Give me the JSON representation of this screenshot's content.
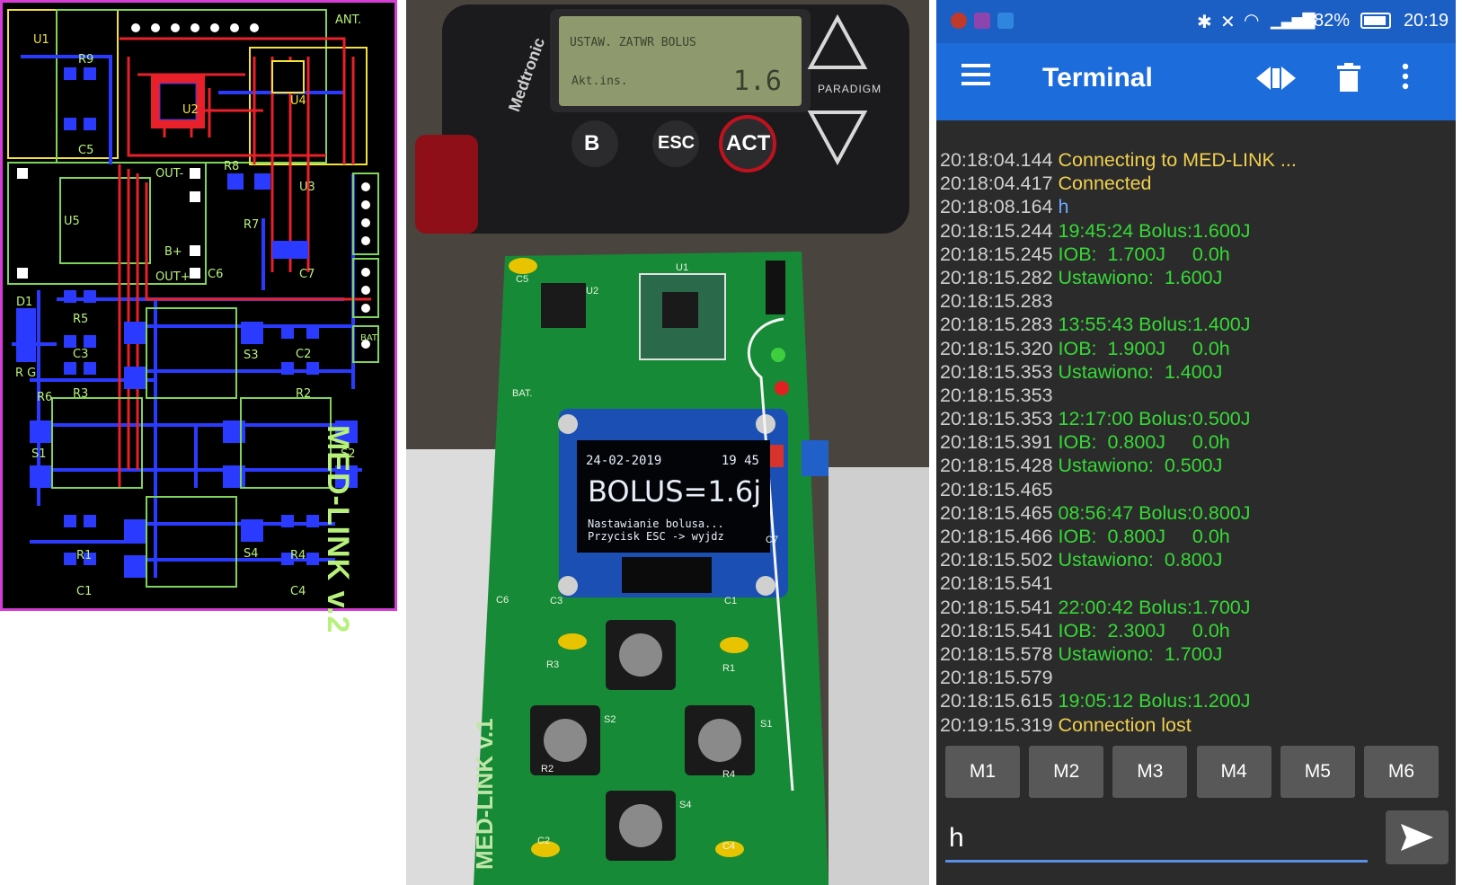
{
  "pcb": {
    "labels": {
      "u1": "U1",
      "u2": "U2",
      "u4": "U4",
      "u3": "U3",
      "u5": "U5",
      "r9": "R9",
      "r8": "R8",
      "r7": "R7",
      "r5": "R5",
      "r3": "R3",
      "r2": "R2",
      "r1": "R1",
      "r4": "R4",
      "r6": "R6",
      "c5": "C5",
      "c6": "C6",
      "c7": "C7",
      "c3": "C3",
      "c2": "C2",
      "c1": "C1",
      "c4": "C4",
      "d1": "D1",
      "s1": "S1",
      "s2": "S2",
      "s3": "S3",
      "s4": "S4",
      "ant": "ANT.",
      "b": "B+",
      "out_minus": "OUT-",
      "out_plus": "OUT+",
      "bat": "BAT.",
      "rg": "R G"
    },
    "board_title": "MED-LINK v.2"
  },
  "photo": {
    "pump_screen": {
      "line1": "USTAW. ZATWR BOLUS",
      "line2": "Akt.ins.",
      "value": "1.6"
    },
    "pump_brand": "Medtronic",
    "paradigm": "PARADIGM",
    "pump_buttons": {
      "b": "B",
      "esc": "ESC",
      "act": "ACT"
    },
    "oled": {
      "date": "24-02-2019",
      "time": "19 45",
      "bolus": "BOLUS=1.6j",
      "line1": "Nastawianie bolusa...",
      "line2": "Przycisk ESC -> wyjdz"
    },
    "board_labels": {
      "bat": "BAT.",
      "u1": "U1",
      "u2": "U2",
      "c5": "C5",
      "c6": "C6",
      "c7": "C7",
      "c3": "C3",
      "c1": "C1",
      "c2": "C2",
      "c4": "C4",
      "r1": "R1",
      "r2": "R2",
      "r3": "R3",
      "r4": "R4",
      "s1": "S1",
      "s2": "S2",
      "s4": "S4"
    },
    "board_name": "MED-LINK v.1"
  },
  "phone": {
    "status": {
      "battery": "82%",
      "time": "20:19"
    },
    "toolbar": {
      "title": "Terminal",
      "menu_icon": "hamburger-icon",
      "connect_icon": "connect-icon",
      "delete_icon": "trash-icon",
      "more_icon": "more-vert-icon"
    },
    "colors": {
      "yellow": "#f0cf4e",
      "green": "#36d936",
      "blue": "#6ea8ff",
      "ts": "#cfcfcf"
    },
    "log": [
      {
        "ts": "20:18:04.144",
        "msg": "Connecting to MED-LINK ...",
        "kind": "yellow"
      },
      {
        "ts": "20:18:04.417",
        "msg": "Connected",
        "kind": "yellow"
      },
      {
        "ts": "20:18:08.164",
        "msg": "h",
        "kind": "blue"
      },
      {
        "ts": "20:18:15.244",
        "msg": "19:45:24 Bolus:1.600J",
        "kind": "green"
      },
      {
        "ts": "20:18:15.245",
        "msg": "IOB:  1.700J     0.0h",
        "kind": "green"
      },
      {
        "ts": "20:18:15.282",
        "msg": "Ustawiono:  1.600J",
        "kind": "green"
      },
      {
        "ts": "20:18:15.283",
        "msg": "",
        "kind": "green"
      },
      {
        "ts": "20:18:15.283",
        "msg": "13:55:43 Bolus:1.400J",
        "kind": "green"
      },
      {
        "ts": "20:18:15.320",
        "msg": "IOB:  1.900J     0.0h",
        "kind": "green"
      },
      {
        "ts": "20:18:15.353",
        "msg": "Ustawiono:  1.400J",
        "kind": "green"
      },
      {
        "ts": "20:18:15.353",
        "msg": "",
        "kind": "green"
      },
      {
        "ts": "20:18:15.353",
        "msg": "12:17:00 Bolus:0.500J",
        "kind": "green"
      },
      {
        "ts": "20:18:15.391",
        "msg": "IOB:  0.800J     0.0h",
        "kind": "green"
      },
      {
        "ts": "20:18:15.428",
        "msg": "Ustawiono:  0.500J",
        "kind": "green"
      },
      {
        "ts": "20:18:15.465",
        "msg": "",
        "kind": "green"
      },
      {
        "ts": "20:18:15.465",
        "msg": "08:56:47 Bolus:0.800J",
        "kind": "green"
      },
      {
        "ts": "20:18:15.466",
        "msg": "IOB:  0.800J     0.0h",
        "kind": "green"
      },
      {
        "ts": "20:18:15.502",
        "msg": "Ustawiono:  0.800J",
        "kind": "green"
      },
      {
        "ts": "20:18:15.541",
        "msg": "",
        "kind": "green"
      },
      {
        "ts": "20:18:15.541",
        "msg": "22:00:42 Bolus:1.700J",
        "kind": "green"
      },
      {
        "ts": "20:18:15.541",
        "msg": "IOB:  2.300J     0.0h",
        "kind": "green"
      },
      {
        "ts": "20:18:15.578",
        "msg": "Ustawiono:  1.700J",
        "kind": "green"
      },
      {
        "ts": "20:18:15.579",
        "msg": "",
        "kind": "green"
      },
      {
        "ts": "20:18:15.615",
        "msg": "19:05:12 Bolus:1.200J",
        "kind": "green"
      },
      {
        "ts": "20:19:15.319",
        "msg": "Connection lost",
        "kind": "yellow"
      }
    ],
    "macro_buttons": [
      "M1",
      "M2",
      "M3",
      "M4",
      "M5",
      "M6"
    ],
    "input_value": "h",
    "send_icon": "send-icon"
  }
}
